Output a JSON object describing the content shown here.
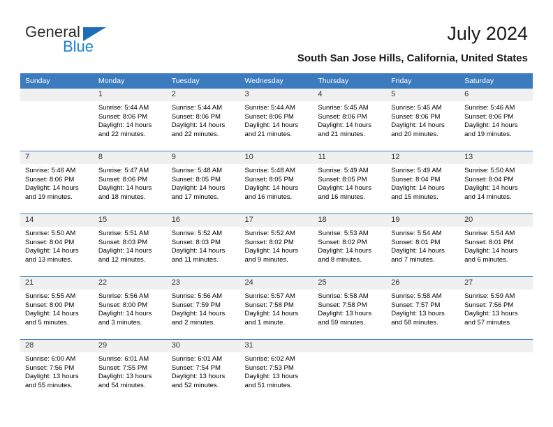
{
  "brand": {
    "name_part1": "General",
    "name_part2": "Blue",
    "accent_color": "#1f7fd0",
    "triangle_color": "#1d6fb8"
  },
  "header": {
    "title": "July 2024",
    "subtitle": "South San Jose Hills, California, United States"
  },
  "theme": {
    "header_row_bg": "#3c7cbe",
    "daynum_bg": "#f0f0f0",
    "grid_line": "#3c7cbe"
  },
  "weekday_headers": [
    "Sunday",
    "Monday",
    "Tuesday",
    "Wednesday",
    "Thursday",
    "Friday",
    "Saturday"
  ],
  "labels": {
    "sunrise_prefix": "Sunrise:",
    "sunset_prefix": "Sunset:",
    "daylight_prefix": "Daylight:"
  },
  "weeks": [
    [
      {
        "day": "",
        "sunrise": "",
        "sunset": "",
        "daylight_line1": "",
        "daylight_line2": "",
        "empty": true
      },
      {
        "day": "1",
        "sunrise": "Sunrise: 5:44 AM",
        "sunset": "Sunset: 8:06 PM",
        "daylight_line1": "Daylight: 14 hours",
        "daylight_line2": "and 22 minutes."
      },
      {
        "day": "2",
        "sunrise": "Sunrise: 5:44 AM",
        "sunset": "Sunset: 8:06 PM",
        "daylight_line1": "Daylight: 14 hours",
        "daylight_line2": "and 22 minutes."
      },
      {
        "day": "3",
        "sunrise": "Sunrise: 5:44 AM",
        "sunset": "Sunset: 8:06 PM",
        "daylight_line1": "Daylight: 14 hours",
        "daylight_line2": "and 21 minutes."
      },
      {
        "day": "4",
        "sunrise": "Sunrise: 5:45 AM",
        "sunset": "Sunset: 8:06 PM",
        "daylight_line1": "Daylight: 14 hours",
        "daylight_line2": "and 21 minutes."
      },
      {
        "day": "5",
        "sunrise": "Sunrise: 5:45 AM",
        "sunset": "Sunset: 8:06 PM",
        "daylight_line1": "Daylight: 14 hours",
        "daylight_line2": "and 20 minutes."
      },
      {
        "day": "6",
        "sunrise": "Sunrise: 5:46 AM",
        "sunset": "Sunset: 8:06 PM",
        "daylight_line1": "Daylight: 14 hours",
        "daylight_line2": "and 19 minutes."
      }
    ],
    [
      {
        "day": "7",
        "sunrise": "Sunrise: 5:46 AM",
        "sunset": "Sunset: 8:06 PM",
        "daylight_line1": "Daylight: 14 hours",
        "daylight_line2": "and 19 minutes."
      },
      {
        "day": "8",
        "sunrise": "Sunrise: 5:47 AM",
        "sunset": "Sunset: 8:06 PM",
        "daylight_line1": "Daylight: 14 hours",
        "daylight_line2": "and 18 minutes."
      },
      {
        "day": "9",
        "sunrise": "Sunrise: 5:48 AM",
        "sunset": "Sunset: 8:05 PM",
        "daylight_line1": "Daylight: 14 hours",
        "daylight_line2": "and 17 minutes."
      },
      {
        "day": "10",
        "sunrise": "Sunrise: 5:48 AM",
        "sunset": "Sunset: 8:05 PM",
        "daylight_line1": "Daylight: 14 hours",
        "daylight_line2": "and 16 minutes."
      },
      {
        "day": "11",
        "sunrise": "Sunrise: 5:49 AM",
        "sunset": "Sunset: 8:05 PM",
        "daylight_line1": "Daylight: 14 hours",
        "daylight_line2": "and 16 minutes."
      },
      {
        "day": "12",
        "sunrise": "Sunrise: 5:49 AM",
        "sunset": "Sunset: 8:04 PM",
        "daylight_line1": "Daylight: 14 hours",
        "daylight_line2": "and 15 minutes."
      },
      {
        "day": "13",
        "sunrise": "Sunrise: 5:50 AM",
        "sunset": "Sunset: 8:04 PM",
        "daylight_line1": "Daylight: 14 hours",
        "daylight_line2": "and 14 minutes."
      }
    ],
    [
      {
        "day": "14",
        "sunrise": "Sunrise: 5:50 AM",
        "sunset": "Sunset: 8:04 PM",
        "daylight_line1": "Daylight: 14 hours",
        "daylight_line2": "and 13 minutes."
      },
      {
        "day": "15",
        "sunrise": "Sunrise: 5:51 AM",
        "sunset": "Sunset: 8:03 PM",
        "daylight_line1": "Daylight: 14 hours",
        "daylight_line2": "and 12 minutes."
      },
      {
        "day": "16",
        "sunrise": "Sunrise: 5:52 AM",
        "sunset": "Sunset: 8:03 PM",
        "daylight_line1": "Daylight: 14 hours",
        "daylight_line2": "and 11 minutes."
      },
      {
        "day": "17",
        "sunrise": "Sunrise: 5:52 AM",
        "sunset": "Sunset: 8:02 PM",
        "daylight_line1": "Daylight: 14 hours",
        "daylight_line2": "and 9 minutes."
      },
      {
        "day": "18",
        "sunrise": "Sunrise: 5:53 AM",
        "sunset": "Sunset: 8:02 PM",
        "daylight_line1": "Daylight: 14 hours",
        "daylight_line2": "and 8 minutes."
      },
      {
        "day": "19",
        "sunrise": "Sunrise: 5:54 AM",
        "sunset": "Sunset: 8:01 PM",
        "daylight_line1": "Daylight: 14 hours",
        "daylight_line2": "and 7 minutes."
      },
      {
        "day": "20",
        "sunrise": "Sunrise: 5:54 AM",
        "sunset": "Sunset: 8:01 PM",
        "daylight_line1": "Daylight: 14 hours",
        "daylight_line2": "and 6 minutes."
      }
    ],
    [
      {
        "day": "21",
        "sunrise": "Sunrise: 5:55 AM",
        "sunset": "Sunset: 8:00 PM",
        "daylight_line1": "Daylight: 14 hours",
        "daylight_line2": "and 5 minutes."
      },
      {
        "day": "22",
        "sunrise": "Sunrise: 5:56 AM",
        "sunset": "Sunset: 8:00 PM",
        "daylight_line1": "Daylight: 14 hours",
        "daylight_line2": "and 3 minutes."
      },
      {
        "day": "23",
        "sunrise": "Sunrise: 5:56 AM",
        "sunset": "Sunset: 7:59 PM",
        "daylight_line1": "Daylight: 14 hours",
        "daylight_line2": "and 2 minutes."
      },
      {
        "day": "24",
        "sunrise": "Sunrise: 5:57 AM",
        "sunset": "Sunset: 7:58 PM",
        "daylight_line1": "Daylight: 14 hours",
        "daylight_line2": "and 1 minute."
      },
      {
        "day": "25",
        "sunrise": "Sunrise: 5:58 AM",
        "sunset": "Sunset: 7:58 PM",
        "daylight_line1": "Daylight: 13 hours",
        "daylight_line2": "and 59 minutes."
      },
      {
        "day": "26",
        "sunrise": "Sunrise: 5:58 AM",
        "sunset": "Sunset: 7:57 PM",
        "daylight_line1": "Daylight: 13 hours",
        "daylight_line2": "and 58 minutes."
      },
      {
        "day": "27",
        "sunrise": "Sunrise: 5:59 AM",
        "sunset": "Sunset: 7:56 PM",
        "daylight_line1": "Daylight: 13 hours",
        "daylight_line2": "and 57 minutes."
      }
    ],
    [
      {
        "day": "28",
        "sunrise": "Sunrise: 6:00 AM",
        "sunset": "Sunset: 7:56 PM",
        "daylight_line1": "Daylight: 13 hours",
        "daylight_line2": "and 55 minutes."
      },
      {
        "day": "29",
        "sunrise": "Sunrise: 6:01 AM",
        "sunset": "Sunset: 7:55 PM",
        "daylight_line1": "Daylight: 13 hours",
        "daylight_line2": "and 54 minutes."
      },
      {
        "day": "30",
        "sunrise": "Sunrise: 6:01 AM",
        "sunset": "Sunset: 7:54 PM",
        "daylight_line1": "Daylight: 13 hours",
        "daylight_line2": "and 52 minutes."
      },
      {
        "day": "31",
        "sunrise": "Sunrise: 6:02 AM",
        "sunset": "Sunset: 7:53 PM",
        "daylight_line1": "Daylight: 13 hours",
        "daylight_line2": "and 51 minutes."
      },
      {
        "day": "",
        "sunrise": "",
        "sunset": "",
        "daylight_line1": "",
        "daylight_line2": "",
        "empty": true
      },
      {
        "day": "",
        "sunrise": "",
        "sunset": "",
        "daylight_line1": "",
        "daylight_line2": "",
        "empty": true
      },
      {
        "day": "",
        "sunrise": "",
        "sunset": "",
        "daylight_line1": "",
        "daylight_line2": "",
        "empty": true
      }
    ]
  ]
}
